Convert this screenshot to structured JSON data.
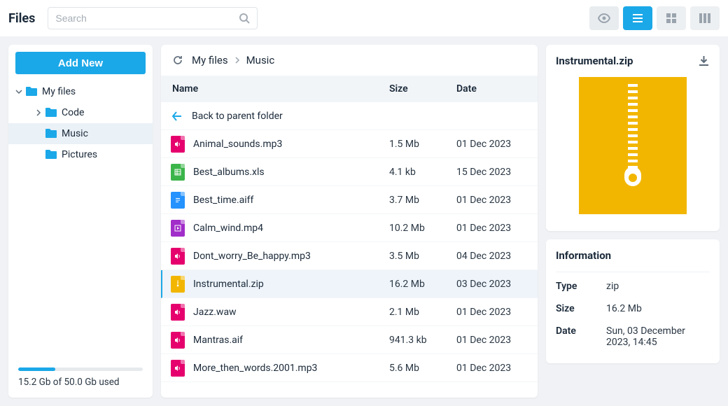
{
  "app_title": "Files",
  "search_placeholder": "Search",
  "sidebar": {
    "add_button": "Add New",
    "items": [
      {
        "label": "My files",
        "depth": 0,
        "expanded": true,
        "selected": false
      },
      {
        "label": "Code",
        "depth": 1,
        "expanded": false,
        "has_children": true,
        "selected": false
      },
      {
        "label": "Music",
        "depth": 1,
        "selected": true
      },
      {
        "label": "Pictures",
        "depth": 1,
        "selected": false
      }
    ]
  },
  "storage": {
    "text": "15.2 Gb of 50.0 Gb used",
    "percent": 30
  },
  "breadcrumb": {
    "items": [
      "My files",
      "Music"
    ]
  },
  "table": {
    "headers": {
      "name": "Name",
      "size": "Size",
      "date": "Date"
    },
    "back_label": "Back to parent folder"
  },
  "files": [
    {
      "name": "Animal_sounds.mp3",
      "size": "1.5 Mb",
      "date": "01 Dec 2023",
      "type": "audio",
      "selected": false
    },
    {
      "name": "Best_albums.xls",
      "size": "4.1 kb",
      "date": "15 Dec 2023",
      "type": "xls",
      "selected": false
    },
    {
      "name": "Best_time.aiff",
      "size": "3.7 Mb",
      "date": "01 Dec 2023",
      "type": "doc",
      "selected": false
    },
    {
      "name": "Calm_wind.mp4",
      "size": "10.2 Mb",
      "date": "01 Dec 2023",
      "type": "video",
      "selected": false
    },
    {
      "name": "Dont_worry_Be_happy.mp3",
      "size": "3.5 Mb",
      "date": "04 Dec 2023",
      "type": "audio",
      "selected": false
    },
    {
      "name": "Instrumental.zip",
      "size": "16.2 Mb",
      "date": "03 Dec 2023",
      "type": "zip",
      "selected": true
    },
    {
      "name": "Jazz.waw",
      "size": "2.1 Mb",
      "date": "01 Dec 2023",
      "type": "audio",
      "selected": false
    },
    {
      "name": "Mantras.aif",
      "size": "941.3 kb",
      "date": "01 Dec 2023",
      "type": "audio",
      "selected": false
    },
    {
      "name": "More_then_words.2001.mp3",
      "size": "5.6 Mb",
      "date": "01 Dec 2023",
      "type": "audio",
      "selected": false
    }
  ],
  "preview": {
    "filename": "Instrumental.zip"
  },
  "info": {
    "title": "Information",
    "rows": [
      {
        "label": "Type",
        "value": "zip"
      },
      {
        "label": "Size",
        "value": "16.2 Mb"
      },
      {
        "label": "Date",
        "value": "Sun, 03 December 2023, 14:45"
      }
    ]
  }
}
